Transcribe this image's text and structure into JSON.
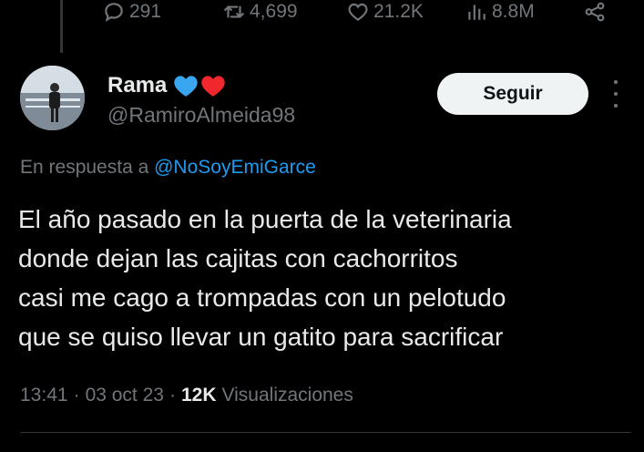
{
  "actions": {
    "replies": "291",
    "retweets": "4,699",
    "likes": "21.2K",
    "views": "8.8M"
  },
  "author": {
    "name": "Rama",
    "handle": "@RamiroAlmeida98",
    "follow_label": "Seguir",
    "name_emojis": [
      "blue-heart-icon",
      "red-heart-icon"
    ]
  },
  "reply_to": {
    "prefix": "En respuesta a",
    "mention": "@NoSoyEmiGarce"
  },
  "tweet": {
    "lines": [
      "El año pasado en la puerta de la veterinaria",
      "donde dejan las cajitas con cachorritos",
      "casi me cago a trompadas con un pelotudo",
      "que se quiso llevar un gatito para sacrificar"
    ]
  },
  "meta": {
    "time": "13:41",
    "sep1": "·",
    "date": "03 oct 23",
    "sep2": "·",
    "views_count": "12K",
    "views_label": "Visualizaciones"
  },
  "colors": {
    "background": "#000000",
    "text": "#e7e9ea",
    "secondary": "#71767b",
    "accent": "#1d9bf0",
    "follow_bg": "#eff3f4"
  }
}
